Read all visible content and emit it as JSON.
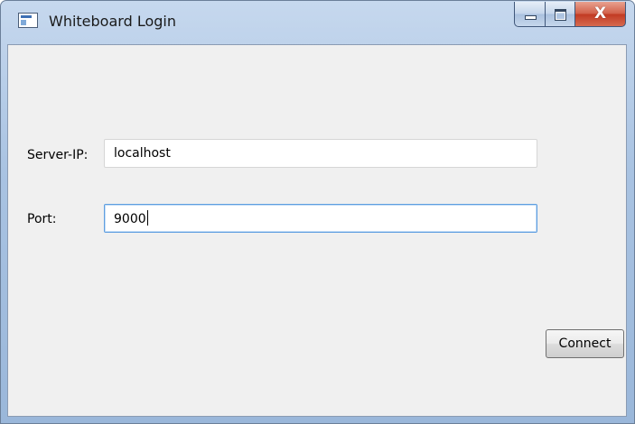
{
  "window": {
    "title": "Whiteboard Login",
    "icon": "app-window-icon",
    "caption_buttons": {
      "minimize_glyph": "—",
      "maximize_glyph": "□",
      "close_glyph": "X"
    }
  },
  "form": {
    "server_ip": {
      "label": "Server-IP:",
      "value": "localhost"
    },
    "port": {
      "label": "Port:",
      "value": "9000",
      "focused": true
    }
  },
  "actions": {
    "connect_label": "Connect"
  }
}
